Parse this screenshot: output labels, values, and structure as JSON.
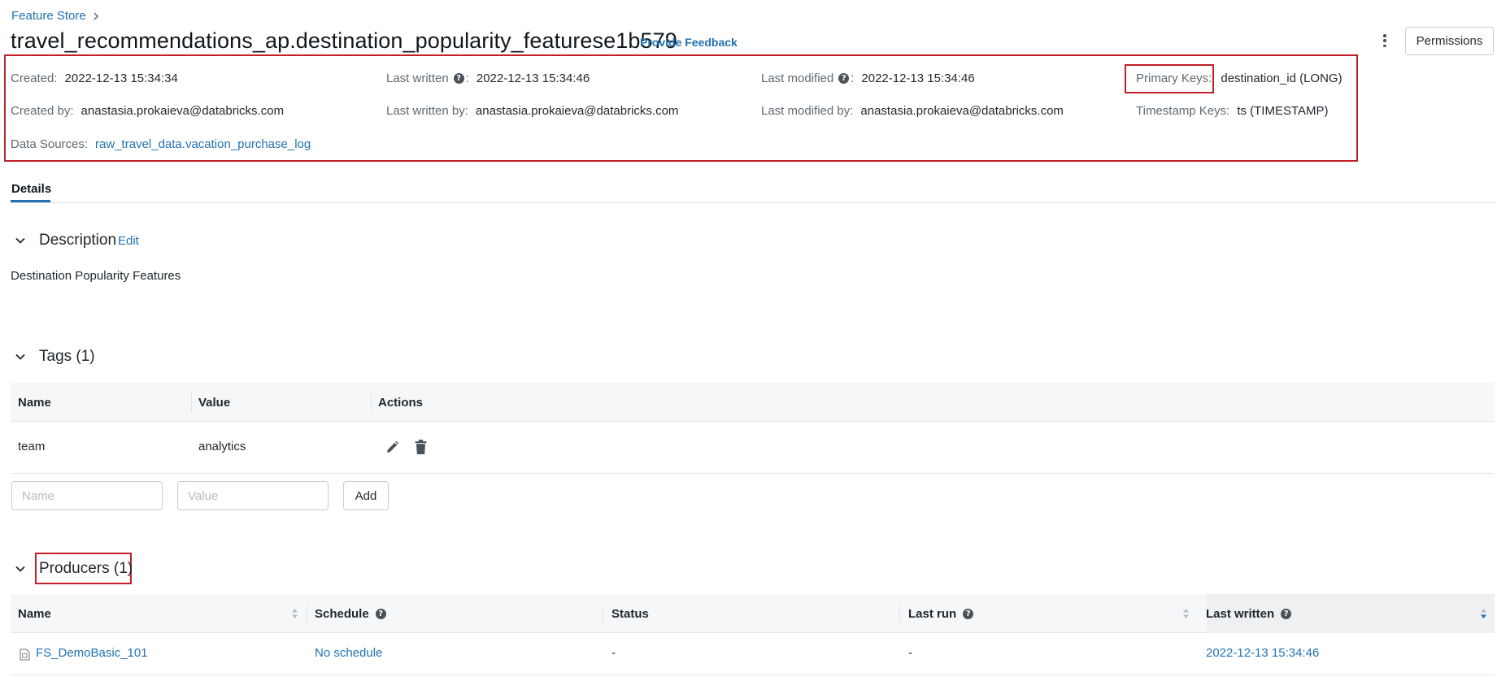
{
  "breadcrumb": {
    "root": "Feature Store"
  },
  "header": {
    "title": "travel_recommendations_ap.destination_popularity_featurese1b579",
    "feedback": "Provide Feedback",
    "permissions": "Permissions"
  },
  "meta": {
    "created_label": "Created:",
    "created_value": "2022-12-13 15:34:34",
    "last_written_label": "Last written",
    "last_written_value": "2022-12-13 15:34:46",
    "last_modified_label": "Last modified",
    "last_modified_value": "2022-12-13 15:34:46",
    "primary_keys_label": "Primary Keys:",
    "primary_keys_value": "destination_id (LONG)",
    "created_by_label": "Created by:",
    "created_by_value": "anastasia.prokaieva@databricks.com",
    "last_written_by_label": "Last written by:",
    "last_written_by_value": "anastasia.prokaieva@databricks.com",
    "last_modified_by_label": "Last modified by:",
    "last_modified_by_value": "anastasia.prokaieva@databricks.com",
    "timestamp_keys_label": "Timestamp Keys:",
    "timestamp_keys_value": "ts (TIMESTAMP)",
    "data_sources_label": "Data Sources:",
    "data_sources_value": "raw_travel_data.vacation_purchase_log",
    "colon": ":"
  },
  "tabs": [
    {
      "label": "Details",
      "active": true
    }
  ],
  "description": {
    "title": "Description",
    "edit": "Edit",
    "text": "Destination Popularity Features"
  },
  "tags": {
    "title": "Tags (1)",
    "columns": [
      "Name",
      "Value",
      "Actions"
    ],
    "rows": [
      {
        "name": "team",
        "value": "analytics"
      }
    ],
    "name_placeholder": "Name",
    "value_placeholder": "Value",
    "add": "Add"
  },
  "producers": {
    "title": "Producers (1)",
    "columns": [
      "Name",
      "Schedule",
      "Status",
      "Last run",
      "Last written"
    ],
    "rows": [
      {
        "name": "FS_DemoBasic_101",
        "schedule": "No schedule",
        "status": "-",
        "last_run": "-",
        "last_written": "2022-12-13 15:34:46"
      }
    ]
  },
  "icons": {
    "help": "?",
    "help_icon": "question-circle-icon",
    "edit_icon": "pencil-icon",
    "delete_icon": "trash-icon",
    "notebook_icon": "notebook-icon"
  },
  "colors": {
    "accent": "#2272b4",
    "highlight": "#c21f28"
  }
}
